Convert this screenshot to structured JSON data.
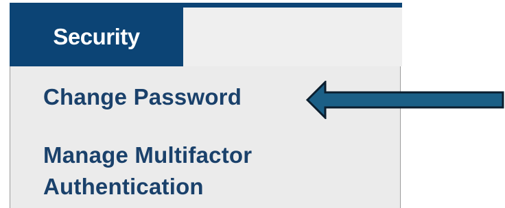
{
  "nav": {
    "security_tab_label": "Security"
  },
  "menu": {
    "change_password_label": "Change Password",
    "manage_mfa_label": "Manage Multifactor Authentication"
  },
  "annotation": {
    "arrow_icon": "left-arrow-icon",
    "arrow_fill": "#1b5f86",
    "arrow_outline": "#0b1e2e"
  },
  "colors": {
    "brand_navy": "#0c4475",
    "menu_text": "#1a416b",
    "menu_background": "#ebebeb"
  }
}
